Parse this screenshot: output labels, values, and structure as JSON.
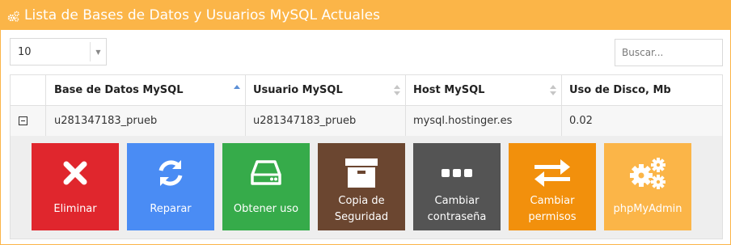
{
  "header": {
    "title": "Lista de Bases de Datos y Usuarios MySQL Actuales",
    "icon": "cogs-icon"
  },
  "controls": {
    "page_length_value": "10",
    "search_placeholder": "Buscar..."
  },
  "table": {
    "columns": [
      "Base de Datos MySQL",
      "Usuario MySQL",
      "Host MySQL",
      "Uso de Disco, Mb"
    ],
    "rows": [
      {
        "database": "u281347183_prueb",
        "user": "u281347183_prueb",
        "host": "mysql.hostinger.es",
        "disk_usage": "0.02"
      }
    ]
  },
  "actions": [
    {
      "label": "Eliminar",
      "color": "#e0262d",
      "icon": "delete-x-icon"
    },
    {
      "label": "Reparar",
      "color": "#4a8cf4",
      "icon": "refresh-icon"
    },
    {
      "label": "Obtener uso",
      "color": "#36ab4a",
      "icon": "drive-icon"
    },
    {
      "label": "Copia de Seguridad",
      "color": "#6b4630",
      "icon": "archive-box-icon"
    },
    {
      "label": "Cambiar contraseña",
      "color": "#545454",
      "icon": "dots-icon"
    },
    {
      "label": "Cambiar permisos",
      "color": "#f2900c",
      "icon": "exchange-arrows-icon"
    },
    {
      "label": "phpMyAdmin",
      "color": "#fbb548",
      "icon": "cogs-icon"
    }
  ],
  "colors": {
    "accent": "#fbb548",
    "sort_active": "#5b8fd6"
  }
}
